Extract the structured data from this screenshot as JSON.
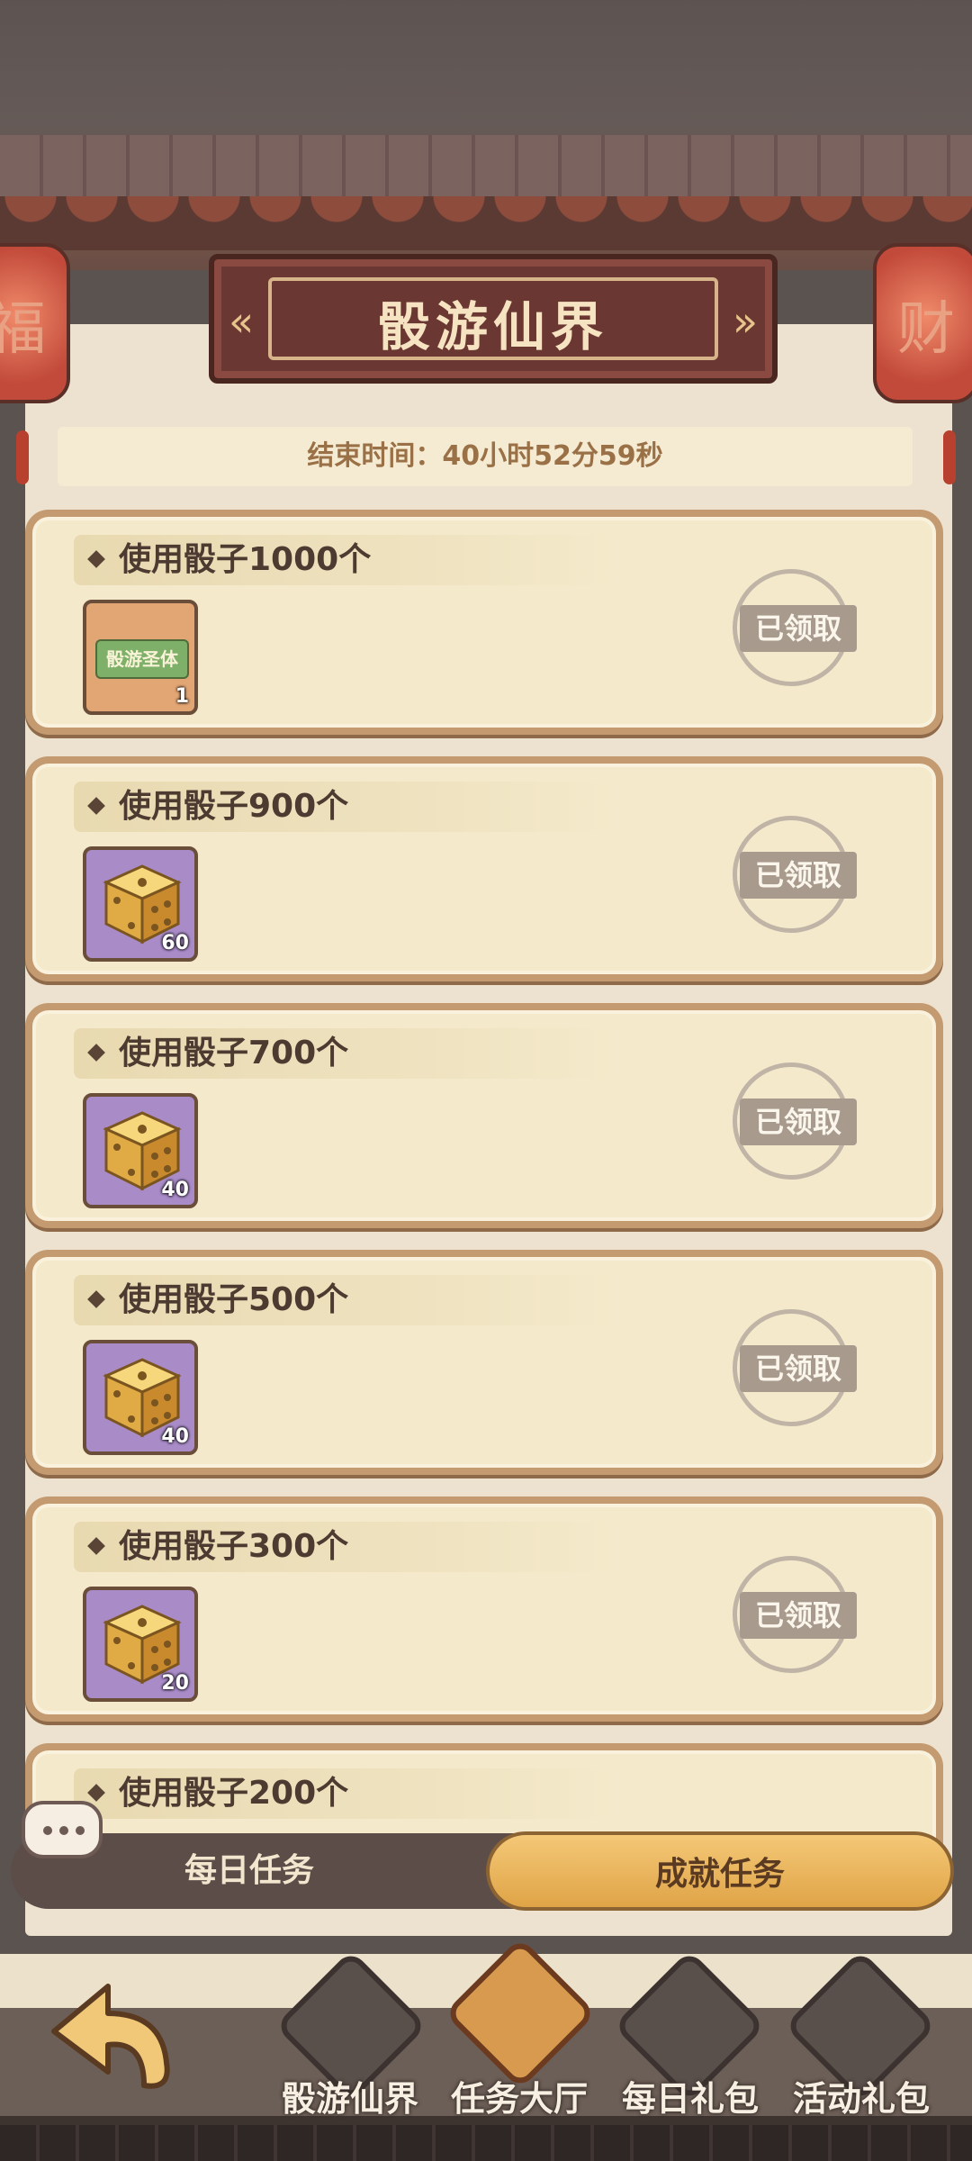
{
  "header": {
    "title": "骰游仙界",
    "lantern_left_char": "福",
    "lantern_right_char": "财"
  },
  "timer": {
    "text": "结束时间：40小时52分59秒"
  },
  "tasks": [
    {
      "title": "使用骰子1000个",
      "reward_type": "scroll",
      "reward_label": "骰游圣体",
      "reward_count": "1",
      "status": "已领取"
    },
    {
      "title": "使用骰子900个",
      "reward_type": "dice",
      "reward_count": "60",
      "status": "已领取"
    },
    {
      "title": "使用骰子700个",
      "reward_type": "dice",
      "reward_count": "40",
      "status": "已领取"
    },
    {
      "title": "使用骰子500个",
      "reward_type": "dice",
      "reward_count": "40",
      "status": "已领取"
    },
    {
      "title": "使用骰子300个",
      "reward_type": "dice",
      "reward_count": "20",
      "status": "已领取"
    },
    {
      "title": "使用骰子200个",
      "reward_type": "dice",
      "reward_count": "",
      "status": ""
    }
  ],
  "tabs": {
    "daily": "每日任务",
    "achievement": "成就任务",
    "active": "achievement"
  },
  "nav": [
    {
      "label": "骰游仙界",
      "icon": "dice-realm-icon",
      "active": false
    },
    {
      "label": "任务大厅",
      "icon": "task-scroll-icon",
      "active": true
    },
    {
      "label": "每日礼包",
      "icon": "gift-bag-icon",
      "active": false
    },
    {
      "label": "活动礼包",
      "icon": "event-bag-icon",
      "active": false
    }
  ],
  "colors": {
    "accent_gold": "#e0a447",
    "card_bg": "#f4eacb",
    "claimed_gray": "#a89b8d"
  }
}
